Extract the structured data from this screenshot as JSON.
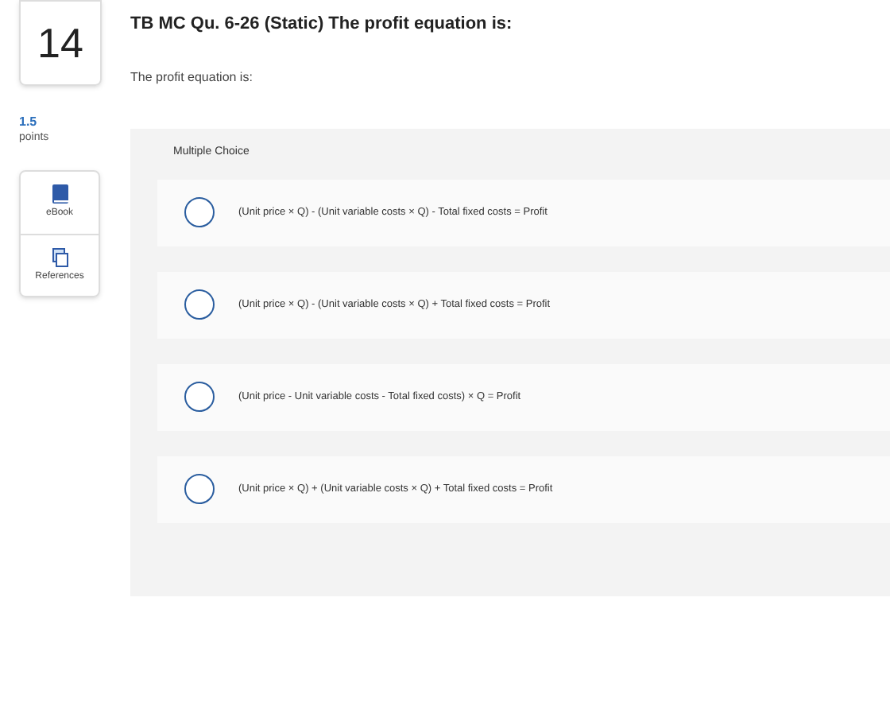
{
  "question_number": "14",
  "title": "TB MC Qu. 6-26 (Static) The profit equation is:",
  "prompt": "The profit equation is:",
  "points": {
    "value": "1.5",
    "label": "points"
  },
  "tools": [
    {
      "kind": "book",
      "label": "eBook"
    },
    {
      "kind": "pages",
      "label": "References"
    }
  ],
  "question_type": "Multiple Choice",
  "options": [
    {
      "text": "(Unit price × Q) - (Unit variable costs × Q) - Total fixed costs = Profit",
      "selected": false
    },
    {
      "text": "(Unit price × Q) - (Unit variable costs × Q) + Total fixed costs = Profit",
      "selected": false
    },
    {
      "text": "(Unit price - Unit variable costs - Total fixed costs) × Q = Profit",
      "selected": false
    },
    {
      "text": "(Unit price × Q) + (Unit variable costs × Q) + Total fixed costs = Profit",
      "selected": false
    }
  ]
}
